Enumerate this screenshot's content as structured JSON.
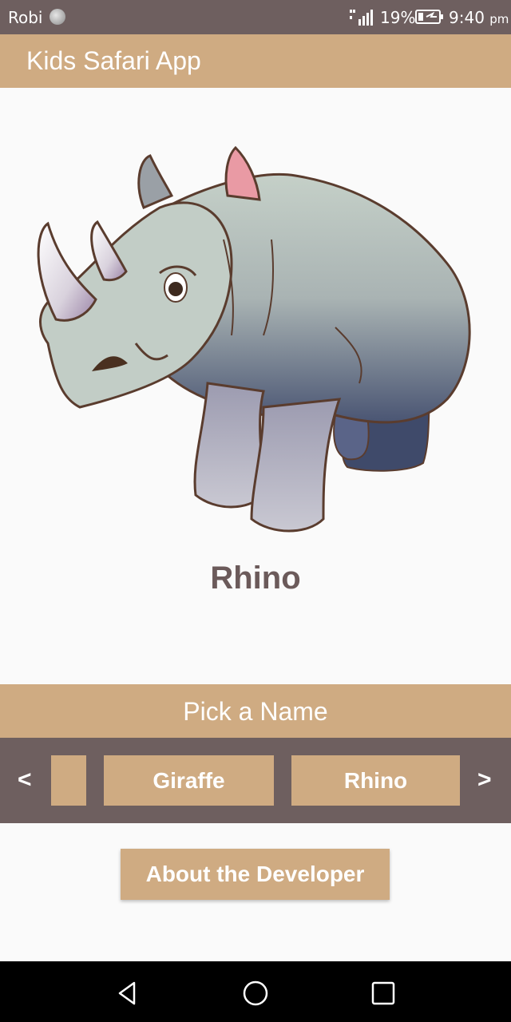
{
  "status_bar": {
    "carrier": "Robi",
    "battery_percent": "19%",
    "time": "9:40",
    "time_suffix": "pm"
  },
  "app_bar": {
    "title": "Kids Safari App"
  },
  "animal": {
    "name": "Rhino",
    "image_icon": "rhino-illustration"
  },
  "pick": {
    "title": "Pick a Name",
    "prev_label": "<",
    "next_label": ">",
    "choices": [
      "",
      "Giraffe",
      "Rhino"
    ]
  },
  "about_button": {
    "label": "About the Developer"
  },
  "colors": {
    "primary": "#cfab82",
    "dark": "#6e5f5f",
    "text_dark": "#6b5a5a",
    "background": "#fafafa"
  },
  "nav_bar": {
    "icons": [
      "back-icon",
      "home-icon",
      "recents-icon"
    ]
  }
}
